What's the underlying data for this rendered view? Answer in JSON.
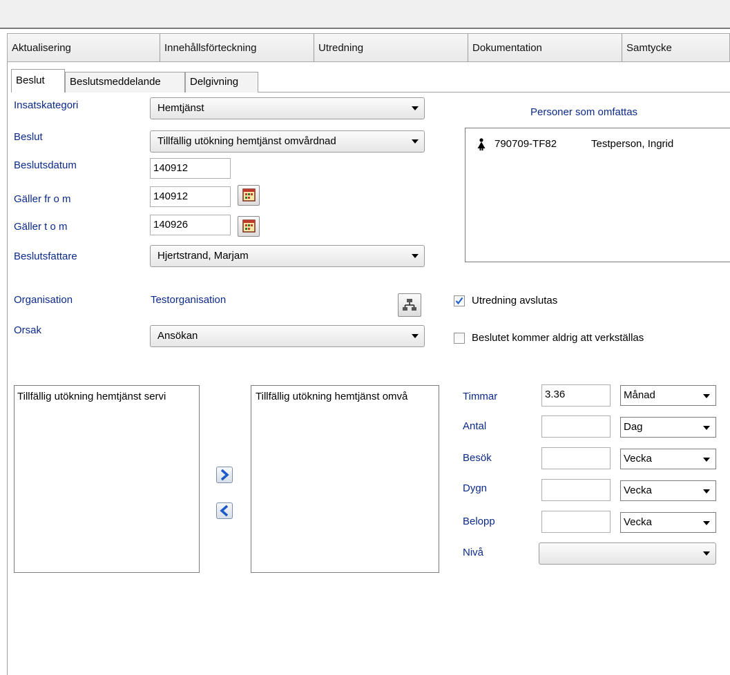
{
  "top_tabs": [
    "Aktualisering",
    "Innehållsförteckning",
    "Utredning",
    "Dokumentation",
    "Samtycke"
  ],
  "sub_tabs": [
    "Beslut",
    "Beslutsmeddelande",
    "Delgivning"
  ],
  "form": {
    "insatskategori": {
      "label": "Insatskategori",
      "value": "Hemtjänst"
    },
    "beslut": {
      "label": "Beslut",
      "value": "Tillfällig utökning hemtjänst omvårdnad"
    },
    "beslutsdatum": {
      "label": "Beslutsdatum",
      "value": "140912"
    },
    "galler_from": {
      "label": "Gäller fr o m",
      "value": "140912"
    },
    "galler_tom": {
      "label": "Gäller t o m",
      "value": "140926"
    },
    "beslutsfattare": {
      "label": "Beslutsfattare",
      "value": "Hjertstrand, Marjam"
    },
    "organisation": {
      "label": "Organisation",
      "value": "Testorganisation"
    },
    "orsak": {
      "label": "Orsak",
      "value": "Ansökan"
    }
  },
  "persons": {
    "heading": "Personer som omfattas",
    "rows": [
      {
        "id": "790709-TF82",
        "name": "Testperson, Ingrid"
      }
    ]
  },
  "checkboxes": {
    "utredning_avslutas": {
      "label": "Utredning avslutas",
      "checked": true
    },
    "aldrig_verkstallas": {
      "label": "Beslutet kommer aldrig att verkställas",
      "checked": false
    }
  },
  "lists": {
    "available": [
      "Tillfällig utökning hemtjänst servi"
    ],
    "selected": [
      "Tillfällig utökning hemtjänst omvå"
    ]
  },
  "quantities": [
    {
      "label": "Timmar",
      "value": "3.36",
      "unit": "Månad"
    },
    {
      "label": "Antal",
      "value": "",
      "unit": "Dag"
    },
    {
      "label": "Besök",
      "value": "",
      "unit": "Vecka"
    },
    {
      "label": "Dygn",
      "value": "",
      "unit": "Vecka"
    },
    {
      "label": "Belopp",
      "value": "",
      "unit": "Vecka"
    }
  ],
  "niva": {
    "label": "Nivå",
    "value": ""
  },
  "colors": {
    "label_blue": "#0b2a8a",
    "check_blue": "#1f5fd0"
  },
  "icons": [
    "calendar-icon",
    "org-tree-icon",
    "person-icon",
    "move-right-icon",
    "move-left-icon",
    "dropdown-arrow-icon",
    "checkmark-icon"
  ]
}
